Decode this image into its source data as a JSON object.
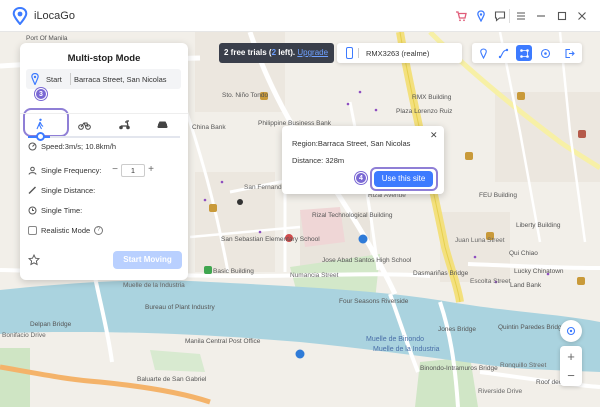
{
  "app": {
    "name": "iLocaGo"
  },
  "title_icons": [
    "cart-icon",
    "pin-icon",
    "chat-icon",
    "menu-icon",
    "minimize-icon",
    "maximize-icon",
    "close-icon"
  ],
  "panel": {
    "title": "Multi-stop Mode",
    "start_label": "Start",
    "start_value": "Barraca Street,  San Nicolas",
    "step_badge": "3",
    "modes": [
      "walk-icon",
      "bike-icon",
      "scooter-icon",
      "car-icon"
    ],
    "speed": "Speed:3m/s; 10.8km/h",
    "single_frequency_label": "Single Frequency:",
    "single_frequency_value": "1",
    "single_distance_label": "Single Distance:",
    "single_time_label": "Single Time:",
    "realistic_mode_label": "Realistic Mode",
    "start_moving": "Start Moving"
  },
  "trial": {
    "prefix": "2 free trials (",
    "count": "2",
    "suffix": " left). ",
    "upgrade": "Upgrade"
  },
  "device": {
    "name": "RMX3263 (realme)"
  },
  "popup": {
    "region": "Region:Barraca Street, San Nicolas",
    "distance": "Distance: 328m",
    "step_badge": "4",
    "use_button": "Use this site"
  },
  "map": {
    "labels": [
      "Port Of Manila",
      "China Bank",
      "Philippine Business Bank",
      "Sto. Niño Tondo",
      "San Fernando Street",
      "Rizal Technological Building",
      "Rizal Avenue",
      "Basic Building",
      "Muelle de la Industria",
      "Delpan Bridge",
      "San Sebastian Elementary School",
      "Bureau of Plant Industry",
      "Manila Central Post Office",
      "Four Seasons Riverside",
      "Jose Abad Santos High School",
      "Dasmariñas Bridge",
      "Binondo-Intramuros Bridge",
      "Muelle de la Industria",
      "Quintin Paredes Bridge",
      "Riverside Drive",
      "Roof deck",
      "Lucky Chinatown",
      "Land Bank",
      "FEU Building",
      "Liberty Building",
      "Qui Chiao",
      "RMX Building",
      "Muelle de Binondo",
      "Juan Luna Street",
      "Numancia Street",
      "Plaza Lorenzo Ruiz",
      "Escolta Street",
      "Baluarte de San Gabriel",
      "Bonifacio Drive",
      "Ronquillo Street",
      "Jones Bridge"
    ]
  },
  "zoom": {
    "in": "+",
    "out": "−"
  }
}
